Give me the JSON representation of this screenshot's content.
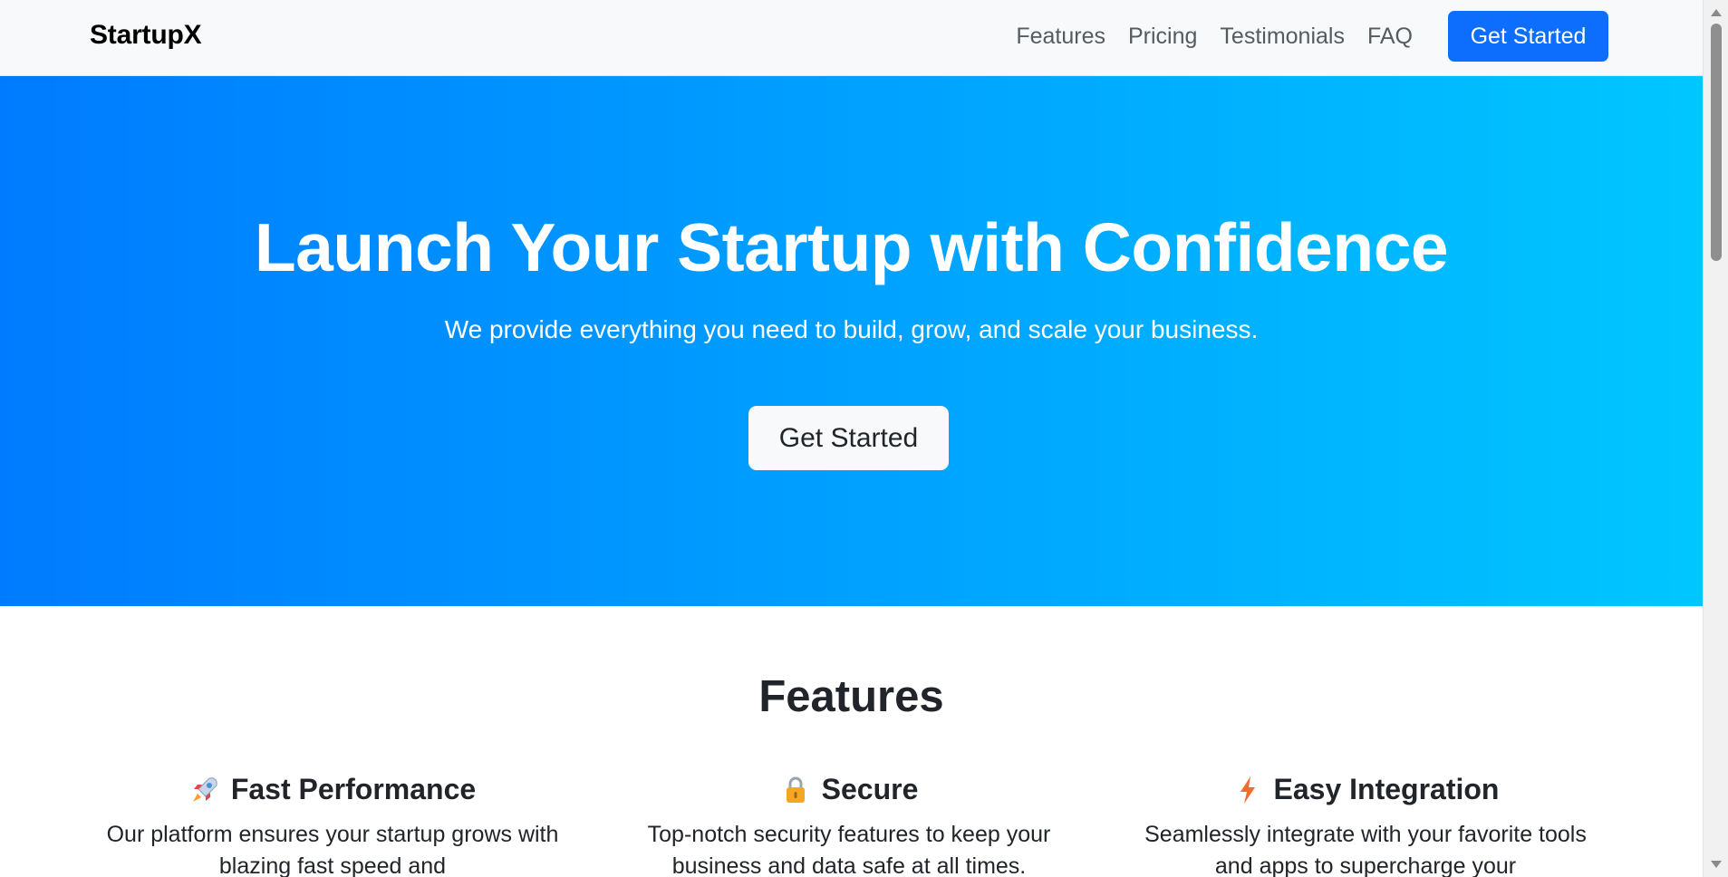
{
  "navbar": {
    "brand": "StartupX",
    "links": [
      "Features",
      "Pricing",
      "Testimonials",
      "FAQ"
    ],
    "cta_label": "Get Started",
    "cta_color": "#0d6efd"
  },
  "hero": {
    "title": "Launch Your Startup with Confidence",
    "subtitle": "We provide everything you need to build, grow, and scale your business.",
    "cta_label": "Get Started",
    "gradient_start": "#007bff",
    "gradient_end": "#00c6ff"
  },
  "features": {
    "heading": "Features",
    "items": [
      {
        "icon": "rocket-icon",
        "title": "Fast Performance",
        "description": "Our platform ensures your startup grows with blazing fast speed and"
      },
      {
        "icon": "lock-icon",
        "title": "Secure",
        "description": "Top-notch security features to keep your business and data safe at all times."
      },
      {
        "icon": "lightning-icon",
        "title": "Easy Integration",
        "description": "Seamlessly integrate with your favorite tools and apps to supercharge your"
      }
    ]
  }
}
